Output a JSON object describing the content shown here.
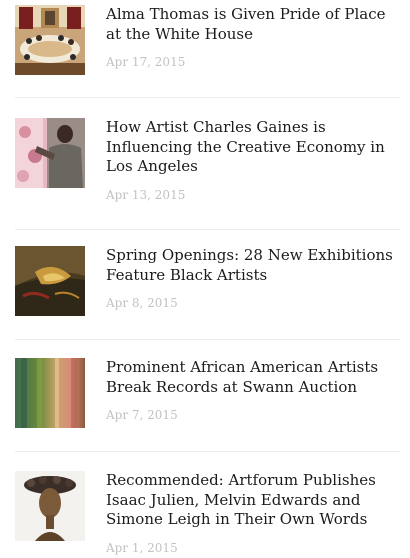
{
  "articles": [
    {
      "title": "Alma Thomas is Given Pride of Place at the White House",
      "date": "Apr 17, 2015",
      "image": "white-house-dining-room-photo"
    },
    {
      "title": "How Artist Charles Gaines is Influencing the Creative Economy in Los Angeles",
      "date": "Apr 13, 2015",
      "image": "artist-at-pink-canvas-photo"
    },
    {
      "title": "Spring Openings: 28 New Exhibitions Feature Black Artists",
      "date": "Apr 8, 2015",
      "image": "abstract-painting-photo"
    },
    {
      "title": "Prominent African American Artists Break Records at Swann Auction",
      "date": "Apr 7, 2015",
      "image": "color-field-painting-photo"
    },
    {
      "title": "Recommended: Artforum Publishes Isaac Julien, Melvin Edwards and Simone Leigh in Their Own Words",
      "date": "Apr 1, 2015",
      "image": "bronze-sculpture-head-photo"
    }
  ]
}
